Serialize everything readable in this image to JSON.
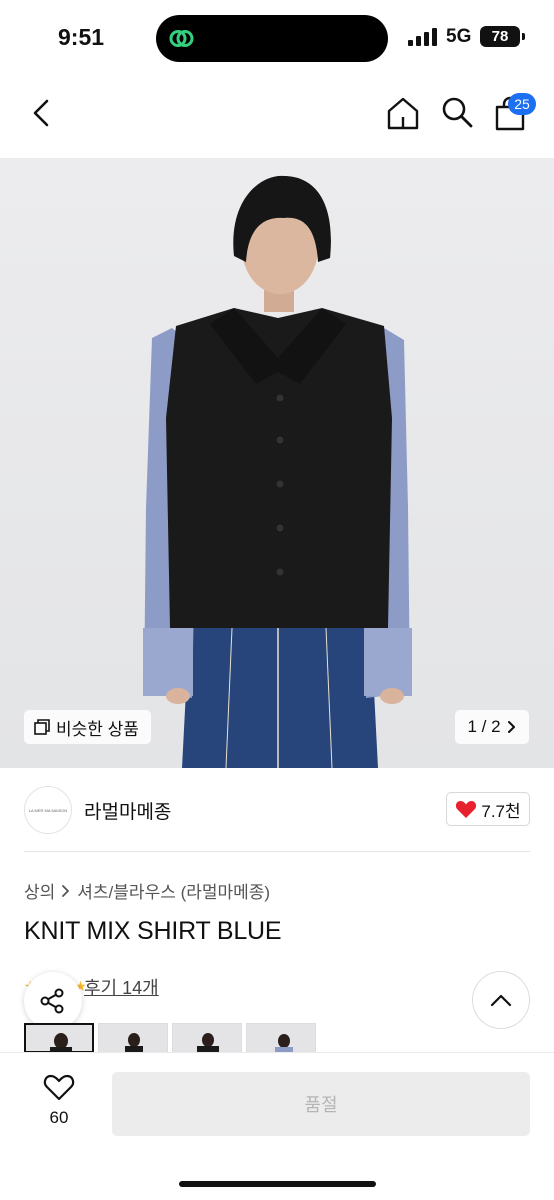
{
  "status_bar": {
    "time": "9:51",
    "network": "5G",
    "battery": "78"
  },
  "nav": {
    "cart_count": "25"
  },
  "hero": {
    "similar_label": "비슷한 상품",
    "pager": "1 / 2"
  },
  "brand": {
    "name": "라멀마메종",
    "logo_text": "LA MER MA MAISON",
    "likes": "7.7천"
  },
  "breadcrumb": [
    "상의",
    "셔츠/블라우스 (라멀마메종)"
  ],
  "product": {
    "title": "KNIT MIX SHIRT BLUE",
    "review_label": "후기 14개"
  },
  "bottom": {
    "wish_count": "60",
    "buy_label": "품절"
  },
  "colors": {
    "accent": "#1d6ff2",
    "heart": "#e8212f",
    "sleeve": "#8d9cc7",
    "body": "#1a1a1a",
    "denim": "#27457a"
  }
}
